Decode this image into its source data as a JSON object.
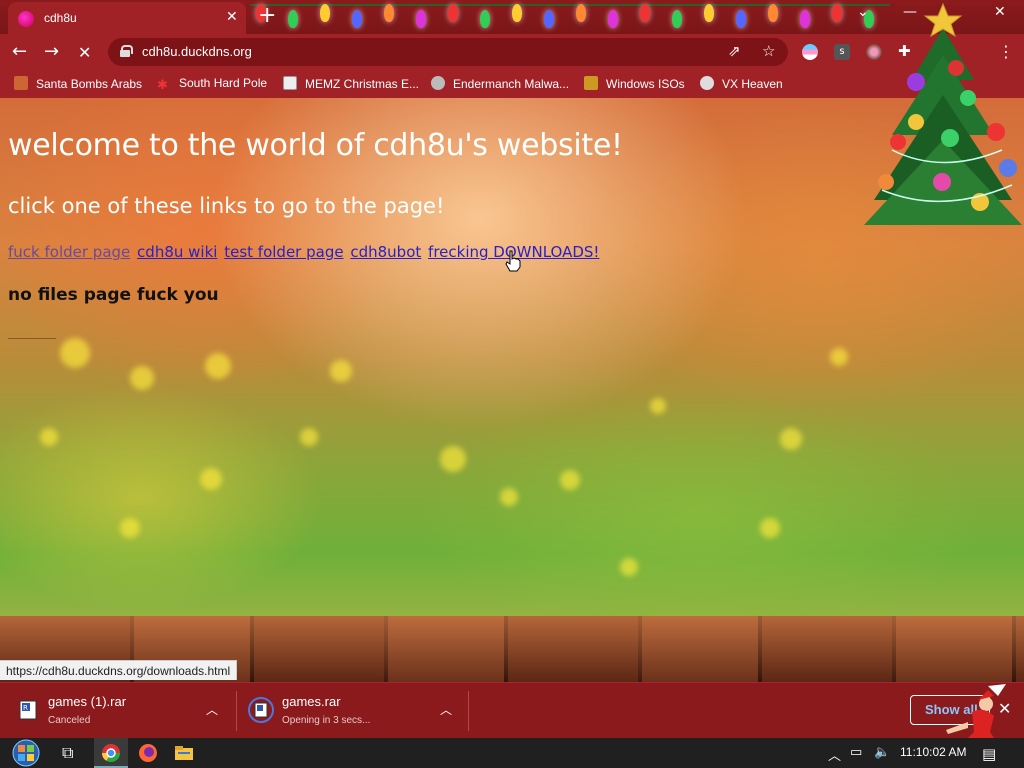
{
  "browser": {
    "tab": {
      "title": "cdh8u"
    },
    "address": {
      "url": "cdh8u.duckdns.org"
    },
    "bookmarks": [
      {
        "label": "Santa Bombs Arabs",
        "icon": "flame-icon"
      },
      {
        "label": "South Hard Pole",
        "icon": "snowflake-icon"
      },
      {
        "label": "MEMZ Christmas E...",
        "icon": "window-icon"
      },
      {
        "label": "Endermanch Malwa...",
        "icon": "face-icon"
      },
      {
        "label": "Windows ISOs",
        "icon": "trophy-icon"
      },
      {
        "label": "VX Heaven",
        "icon": "skull-icon"
      }
    ],
    "status_url": "https://cdh8u.duckdns.org/downloads.html"
  },
  "page": {
    "welcome": "welcome to the world of cdh8u's website!",
    "instruction": "click one of these links to go to the page!",
    "links": [
      {
        "label": "fuck folder page",
        "visited": true
      },
      {
        "label": "cdh8u wiki",
        "visited": false
      },
      {
        "label": "test folder page",
        "visited": false
      },
      {
        "label": "cdh8ubot",
        "visited": false
      },
      {
        "label": "frecking DOWNLOADS!",
        "visited": false
      }
    ],
    "no_files": "no files page fuck you"
  },
  "downloads": {
    "items": [
      {
        "name": "games (1).rar",
        "status": "Canceled"
      },
      {
        "name": "games.rar",
        "status": "Opening in 3 secs..."
      }
    ],
    "show_all": "Show all"
  },
  "taskbar": {
    "time": "11:10:02 AM"
  },
  "colors": {
    "chrome_bg": "#a02226",
    "tabbar_bg": "#8c1a1c",
    "link": "#2a20c8",
    "visited_link": "#6a4a9a",
    "downloads_bg": "#8a1a1c",
    "taskbar_bg": "#202020"
  }
}
